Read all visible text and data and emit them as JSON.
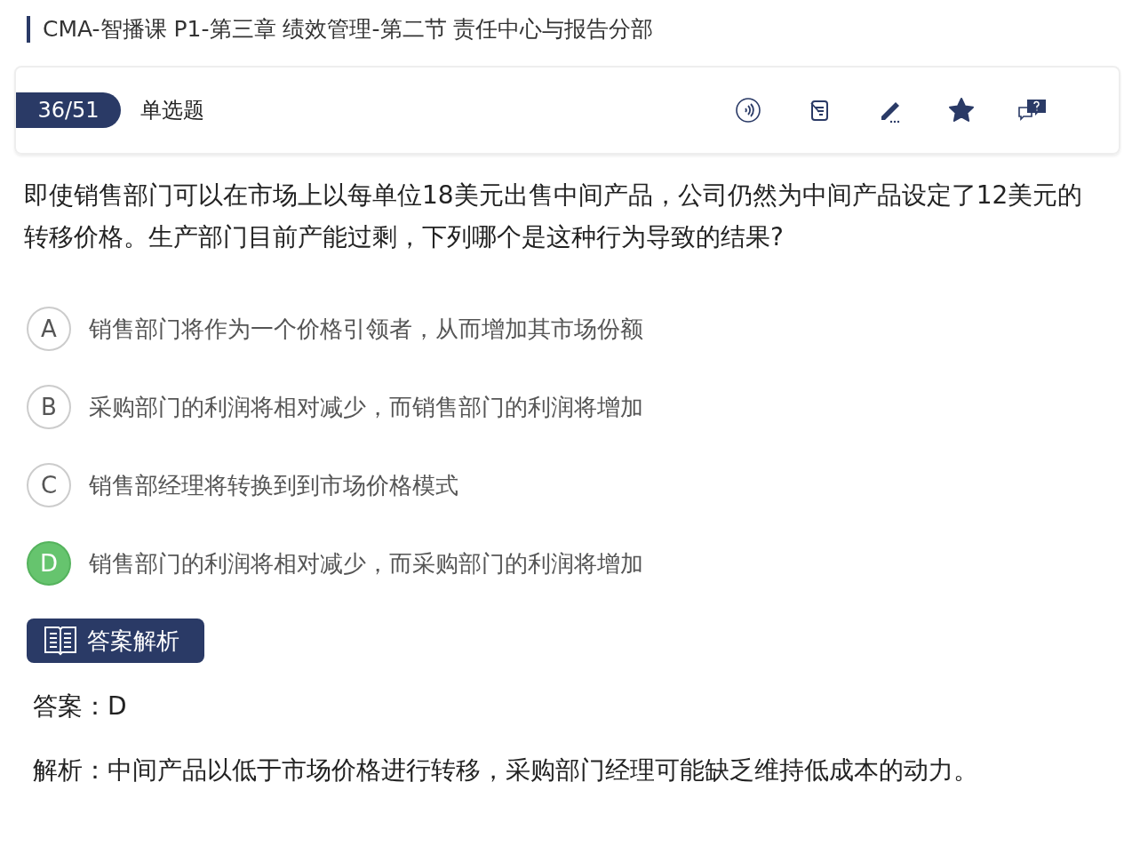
{
  "header": {
    "title": "CMA-智播课 P1-第三章 绩效管理-第二节 责任中心与报告分部"
  },
  "toolbar": {
    "progress": "36/51",
    "question_type": "单选题",
    "starred": true
  },
  "question": "即使销售部门可以在市场上以每单位18美元出售中间产品，公司仍然为中间产品设定了12美元的转移价格。生产部门目前产能过剩，下列哪个是这种行为导致的结果?",
  "options": [
    {
      "letter": "A",
      "text": "销售部门将作为一个价格引领者，从而增加其市场份额",
      "selected": false
    },
    {
      "letter": "B",
      "text": "采购部门的利润将相对减少，而销售部门的利润将增加",
      "selected": false
    },
    {
      "letter": "C",
      "text": "销售部经理将转换到到市场价格模式",
      "selected": false
    },
    {
      "letter": "D",
      "text": "销售部门的利润将相对减少，而采购部门的利润将增加",
      "selected": true
    }
  ],
  "analysis": {
    "heading": "答案解析",
    "answer": "答案：D",
    "explanation": "解析：中间产品以低于市场价格进行转移，采购部门经理可能缺乏维持低成本的动力。"
  }
}
